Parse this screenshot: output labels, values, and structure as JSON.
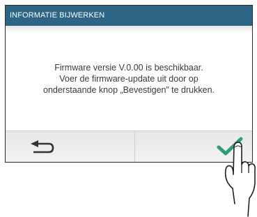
{
  "dialog": {
    "title": "INFORMATIE BIJWERKEN",
    "message_lines": [
      "Firmware versie V.0.00 is beschikbaar.",
      "Voer de firmware-update uit door op",
      "onderstaande knop „Bevestigen” te drukken."
    ]
  },
  "buttons": {
    "back": {
      "icon": "back-arrow-icon"
    },
    "confirm": {
      "icon": "checkmark-icon",
      "color": "#2f9a7c"
    }
  },
  "colors": {
    "title_bar": "#2c6585",
    "title_text": "#ffffff",
    "message_text": "#3a3a3a"
  }
}
